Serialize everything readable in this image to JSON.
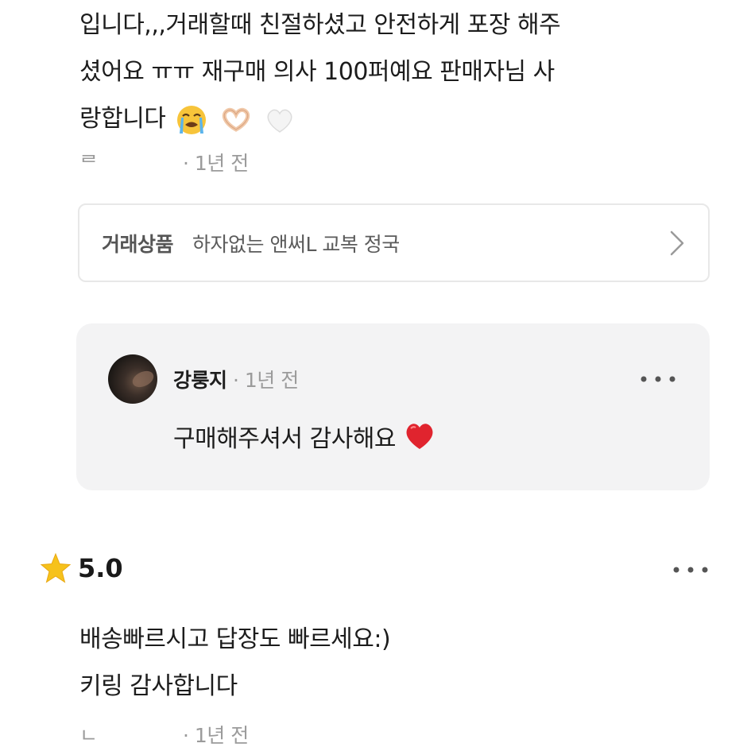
{
  "review1": {
    "lines": [
      "입니다,,,거래할때 친절하셨고 안전하게 포장 해주",
      "셨어요 ㅠㅠ 재구매 의사 100퍼예요 판매자님 사",
      "랑합니다"
    ],
    "emojis": [
      "crying-face-emoji",
      "heart-hands-emoji",
      "white-heart-emoji"
    ],
    "author_initial": "ᄅ",
    "time": "· 1년 전"
  },
  "product": {
    "label": "거래상품",
    "name": "하자없는 앤써L 교복 정국",
    "icon": "chevron-right-icon"
  },
  "reply": {
    "author": "강룽지",
    "dot": " · ",
    "time": "1년 전",
    "text": "구매해주셔서 감사해요",
    "text_emoji": "red-heart-emoji"
  },
  "review2": {
    "rating": "5.0",
    "rating_icon": "star-icon",
    "lines": [
      "배송빠르시고 답장도 빠르세요:)",
      "키링 감사합니다"
    ],
    "author_initial": "ㄴ",
    "time": "· 1년 전"
  },
  "colors": {
    "text": "#1c1c1c",
    "muted": "#9b9b9b",
    "reply_bg": "#f3f3f4",
    "card_border": "#e8e8e8",
    "star": "#f6c21c",
    "heart": "#e0242e"
  }
}
